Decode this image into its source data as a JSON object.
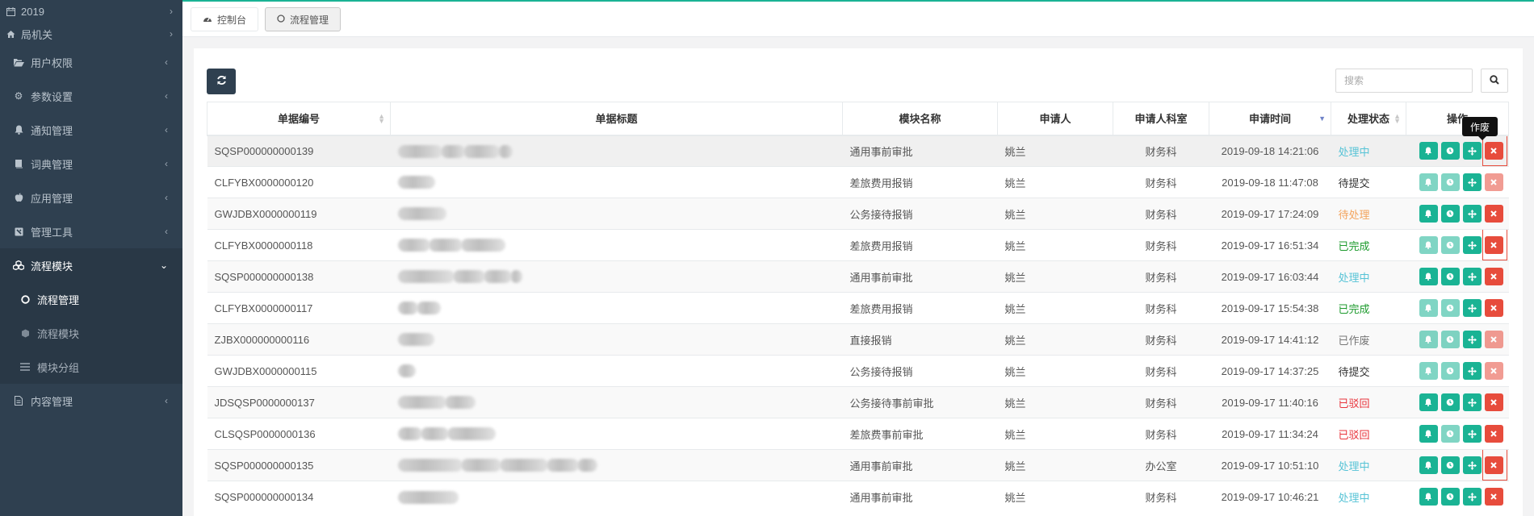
{
  "sidebar": {
    "top_items": [
      {
        "label": "2019",
        "icon": "calendar-icon"
      },
      {
        "label": "局机关",
        "icon": "home-icon"
      }
    ],
    "menu": [
      {
        "label": "用户权限",
        "icon": "folder-open-icon"
      },
      {
        "label": "参数设置",
        "icon": "gear-icon"
      },
      {
        "label": "通知管理",
        "icon": "bell-icon"
      },
      {
        "label": "词典管理",
        "icon": "book-icon"
      },
      {
        "label": "应用管理",
        "icon": "apple-icon"
      },
      {
        "label": "管理工具",
        "icon": "tools-icon"
      },
      {
        "label": "流程模块",
        "icon": "cubes-icon"
      }
    ],
    "submenu": [
      {
        "label": "流程管理",
        "icon": "circle-icon"
      },
      {
        "label": "流程模块",
        "icon": "cube-icon"
      },
      {
        "label": "模块分组",
        "icon": "list-icon"
      }
    ],
    "bottom_item": {
      "label": "内容管理",
      "icon": "file-icon"
    }
  },
  "tabs": [
    {
      "label": "控制台",
      "icon": "dashboard-icon"
    },
    {
      "label": "流程管理",
      "icon": "circle-icon"
    }
  ],
  "toolbar": {
    "search_placeholder": "搜索"
  },
  "table": {
    "headers": [
      "单据编号",
      "单据标题",
      "模块名称",
      "申请人",
      "申请人科室",
      "申请时间",
      "处理状态",
      "操作"
    ],
    "rows": [
      {
        "id": "SQSP000000000139",
        "module": "通用事前审批",
        "applicant": "姚兰",
        "dept": "财务科",
        "time": "2019-09-18 14:21:06",
        "status": "处理中"
      },
      {
        "id": "CLFYBX0000000120",
        "module": "差旅费用报销",
        "applicant": "姚兰",
        "dept": "财务科",
        "time": "2019-09-18 11:47:08",
        "status": "待提交"
      },
      {
        "id": "GWJDBX0000000119",
        "module": "公务接待报销",
        "applicant": "姚兰",
        "dept": "财务科",
        "time": "2019-09-17 17:24:09",
        "status": "待处理"
      },
      {
        "id": "CLFYBX0000000118",
        "module": "差旅费用报销",
        "applicant": "姚兰",
        "dept": "财务科",
        "time": "2019-09-17 16:51:34",
        "status": "已完成"
      },
      {
        "id": "SQSP000000000138",
        "module": "通用事前审批",
        "applicant": "姚兰",
        "dept": "财务科",
        "time": "2019-09-17 16:03:44",
        "status": "处理中"
      },
      {
        "id": "CLFYBX0000000117",
        "module": "差旅费用报销",
        "applicant": "姚兰",
        "dept": "财务科",
        "time": "2019-09-17 15:54:38",
        "status": "已完成"
      },
      {
        "id": "ZJBX000000000116",
        "module": "直接报销",
        "applicant": "姚兰",
        "dept": "财务科",
        "time": "2019-09-17 14:41:12",
        "status": "已作废"
      },
      {
        "id": "GWJDBX0000000115",
        "module": "公务接待报销",
        "applicant": "姚兰",
        "dept": "财务科",
        "time": "2019-09-17 14:37:25",
        "status": "待提交"
      },
      {
        "id": "JDSQSP0000000137",
        "module": "公务接待事前审批",
        "applicant": "姚兰",
        "dept": "财务科",
        "time": "2019-09-17 11:40:16",
        "status": "已驳回"
      },
      {
        "id": "CLSQSP0000000136",
        "module": "差旅费事前审批",
        "applicant": "姚兰",
        "dept": "财务科",
        "time": "2019-09-17 11:34:24",
        "status": "已驳回"
      },
      {
        "id": "SQSP000000000135",
        "module": "通用事前审批",
        "applicant": "姚兰",
        "dept": "办公室",
        "time": "2019-09-17 10:51:10",
        "status": "处理中"
      },
      {
        "id": "SQSP000000000134",
        "module": "通用事前审批",
        "applicant": "姚兰",
        "dept": "财务科",
        "time": "2019-09-17 10:46:21",
        "status": "处理中"
      }
    ]
  },
  "tooltip": "作废",
  "colors": {
    "accent": "#1ab394",
    "danger": "#e74c3c",
    "sidebar": "#2f4050"
  }
}
